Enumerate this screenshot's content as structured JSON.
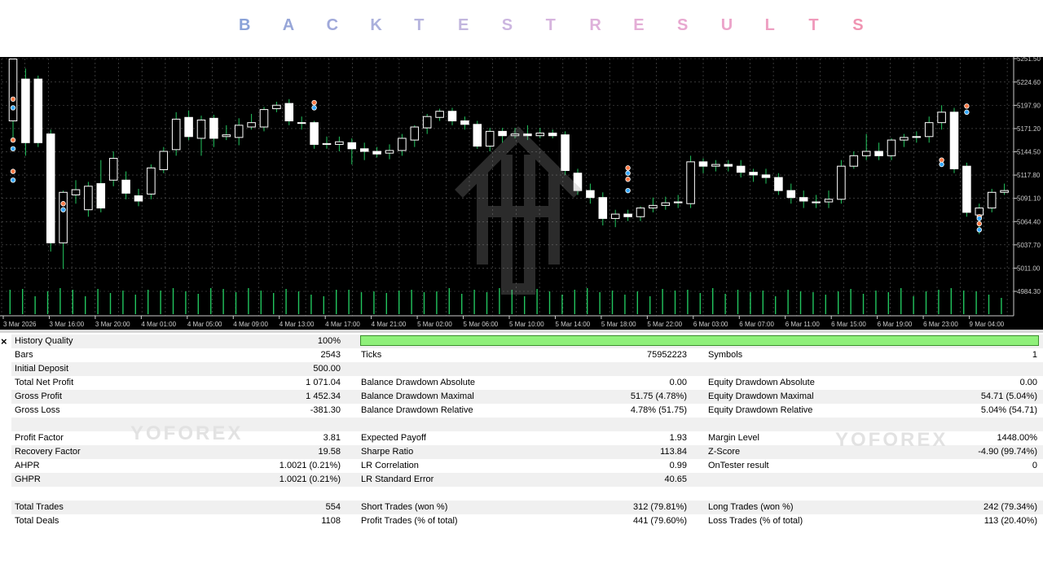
{
  "title_letters": [
    "B",
    "A",
    "C",
    "K",
    "T",
    "E",
    "S",
    "T",
    "R",
    "E",
    "S",
    "U",
    "L",
    "T",
    "S"
  ],
  "title_colors": [
    "#8aa2d8",
    "#97a6d8",
    "#a0a9da",
    "#aab0dc",
    "#b6b4de",
    "#c2b6de",
    "#ccb6e0",
    "#d6b4de",
    "#deb0da",
    "#e4aed6",
    "#e8a8d0",
    "#eca4ca",
    "#ee9fc2",
    "#f09abb",
    "#f094b2"
  ],
  "chart": {
    "price_ticks": [
      "5251.50",
      "5224.60",
      "5197.90",
      "5171.20",
      "5144.50",
      "5117.80",
      "5091.10",
      "5064.40",
      "5037.70",
      "5011.00",
      "4984.30"
    ],
    "time_ticks": [
      "3 Mar 2026",
      "3 Mar 16:00",
      "3 Mar 20:00",
      "4 Mar 01:00",
      "4 Mar 05:00",
      "4 Mar 09:00",
      "4 Mar 13:00",
      "4 Mar 17:00",
      "4 Mar 21:00",
      "5 Mar 02:00",
      "5 Mar 06:00",
      "5 Mar 10:00",
      "5 Mar 14:00",
      "5 Mar 18:00",
      "5 Mar 22:00",
      "6 Mar 03:00",
      "6 Mar 07:00",
      "6 Mar 11:00",
      "6 Mar 15:00",
      "6 Mar 19:00",
      "6 Mar 23:00",
      "9 Mar 04:00"
    ],
    "y_min": 4984.3,
    "y_max": 5251.5,
    "candles": [
      [
        5180,
        5251,
        5251,
        5160
      ],
      [
        5228,
        5155,
        5240,
        5140
      ],
      [
        5228,
        5155,
        5232,
        5150
      ],
      [
        5165,
        5040,
        5170,
        5030
      ],
      [
        5040,
        5098,
        5100,
        5010
      ],
      [
        5095,
        5101,
        5112,
        5085
      ],
      [
        5078,
        5105,
        5110,
        5070
      ],
      [
        5108,
        5080,
        5135,
        5075
      ],
      [
        5112,
        5137,
        5145,
        5105
      ],
      [
        5112,
        5097,
        5122,
        5090
      ],
      [
        5094,
        5088,
        5102,
        5082
      ],
      [
        5096,
        5126,
        5130,
        5090
      ],
      [
        5124,
        5145,
        5150,
        5120
      ],
      [
        5147,
        5182,
        5190,
        5140
      ],
      [
        5184,
        5162,
        5192,
        5158
      ],
      [
        5160,
        5181,
        5186,
        5140
      ],
      [
        5183,
        5160,
        5187,
        5150
      ],
      [
        5162,
        5164,
        5175,
        5158
      ],
      [
        5161,
        5175,
        5183,
        5152
      ],
      [
        5173,
        5178,
        5188,
        5170
      ],
      [
        5173,
        5193,
        5196,
        5168
      ],
      [
        5194,
        5198,
        5202,
        5190
      ],
      [
        5200,
        5180,
        5205,
        5175
      ],
      [
        5178,
        5178,
        5185,
        5170
      ],
      [
        5178,
        5153,
        5180,
        5148
      ],
      [
        5153,
        5154,
        5162,
        5148
      ],
      [
        5153,
        5156,
        5162,
        5145
      ],
      [
        5155,
        5148,
        5160,
        5130
      ],
      [
        5148,
        5145,
        5155,
        5135
      ],
      [
        5145,
        5142,
        5150,
        5138
      ],
      [
        5143,
        5146,
        5153,
        5136
      ],
      [
        5146,
        5160,
        5165,
        5140
      ],
      [
        5158,
        5173,
        5175,
        5150
      ],
      [
        5172,
        5185,
        5188,
        5165
      ],
      [
        5184,
        5191,
        5194,
        5180
      ],
      [
        5191,
        5180,
        5195,
        5175
      ],
      [
        5180,
        5176,
        5185,
        5170
      ],
      [
        5176,
        5151,
        5180,
        5148
      ],
      [
        5151,
        5168,
        5172,
        5145
      ],
      [
        5168,
        5163,
        5172,
        5155
      ],
      [
        5163,
        5165,
        5172,
        5160
      ],
      [
        5165,
        5163,
        5175,
        5158
      ],
      [
        5163,
        5166,
        5172,
        5160
      ],
      [
        5166,
        5163,
        5170,
        5160
      ],
      [
        5164,
        5123,
        5168,
        5118
      ],
      [
        5120,
        5100,
        5125,
        5095
      ],
      [
        5100,
        5092,
        5108,
        5085
      ],
      [
        5092,
        5068,
        5098,
        5060
      ],
      [
        5068,
        5073,
        5078,
        5058
      ],
      [
        5073,
        5070,
        5078,
        5065
      ],
      [
        5070,
        5080,
        5082,
        5065
      ],
      [
        5080,
        5083,
        5092,
        5075
      ],
      [
        5083,
        5086,
        5093,
        5078
      ],
      [
        5086,
        5087,
        5095,
        5080
      ],
      [
        5085,
        5133,
        5140,
        5080
      ],
      [
        5133,
        5128,
        5137,
        5120
      ],
      [
        5128,
        5130,
        5135,
        5122
      ],
      [
        5130,
        5128,
        5135,
        5122
      ],
      [
        5128,
        5121,
        5135,
        5115
      ],
      [
        5121,
        5118,
        5125,
        5110
      ],
      [
        5118,
        5115,
        5125,
        5108
      ],
      [
        5115,
        5100,
        5120,
        5095
      ],
      [
        5100,
        5092,
        5108,
        5085
      ],
      [
        5092,
        5088,
        5100,
        5080
      ],
      [
        5086,
        5087,
        5095,
        5080
      ],
      [
        5087,
        5090,
        5100,
        5080
      ],
      [
        5090,
        5128,
        5135,
        5085
      ],
      [
        5128,
        5140,
        5145,
        5125
      ],
      [
        5140,
        5145,
        5165,
        5135
      ],
      [
        5145,
        5140,
        5155,
        5135
      ],
      [
        5140,
        5158,
        5160,
        5135
      ],
      [
        5158,
        5161,
        5165,
        5150
      ],
      [
        5161,
        5162,
        5168,
        5155
      ],
      [
        5162,
        5178,
        5185,
        5155
      ],
      [
        5178,
        5190,
        5198,
        5170
      ],
      [
        5190,
        5125,
        5195,
        5120
      ],
      [
        5128,
        5075,
        5132,
        5070
      ],
      [
        5072,
        5080,
        5085,
        5050
      ],
      [
        5080,
        5098,
        5102,
        5075
      ],
      [
        5098,
        5100,
        5108,
        5095
      ]
    ],
    "volumes": [
      30,
      31,
      22,
      28,
      32,
      30,
      22,
      31,
      26,
      29,
      24,
      30,
      29,
      32,
      28,
      25,
      32,
      31,
      27,
      32,
      29,
      26,
      31,
      28,
      24,
      22,
      30,
      30,
      27,
      28,
      26,
      29,
      30,
      27,
      28,
      32,
      25,
      30,
      27,
      32,
      30,
      22,
      31,
      28,
      24,
      30,
      32,
      27,
      29,
      24,
      28,
      22,
      31,
      29,
      30,
      26,
      32,
      25,
      30,
      27,
      29,
      22,
      30,
      28,
      27,
      24,
      28,
      31,
      25,
      29,
      27,
      32,
      22,
      28,
      30,
      32,
      29,
      28,
      24,
      20
    ],
    "trade_markers": [
      [
        0,
        5205
      ],
      [
        0,
        5195
      ],
      [
        0,
        5158
      ],
      [
        0,
        5148
      ],
      [
        0,
        5122
      ],
      [
        0,
        5112
      ],
      [
        4,
        5085
      ],
      [
        4,
        5078
      ],
      [
        24,
        5201
      ],
      [
        24,
        5195
      ],
      [
        49,
        5126
      ],
      [
        49,
        5120
      ],
      [
        49,
        5113
      ],
      [
        49,
        5100
      ],
      [
        74,
        5135
      ],
      [
        74,
        5130
      ],
      [
        76,
        5197
      ],
      [
        76,
        5190
      ],
      [
        77,
        5070
      ],
      [
        77,
        5068
      ],
      [
        77,
        5062
      ],
      [
        77,
        5055
      ]
    ]
  },
  "report": {
    "quality": {
      "label": "History Quality",
      "value": "100%"
    },
    "rows": [
      {
        "c1": [
          "Bars",
          "2543"
        ],
        "c2": [
          "Ticks",
          "75952223"
        ],
        "c3": [
          "Symbols",
          "1"
        ]
      },
      {
        "c1": [
          "Initial Deposit",
          "500.00"
        ],
        "c2": [
          "",
          ""
        ],
        "c3": [
          "",
          ""
        ]
      },
      {
        "c1": [
          "Total Net Profit",
          "1 071.04"
        ],
        "c2": [
          "Balance Drawdown Absolute",
          "0.00"
        ],
        "c3": [
          "Equity Drawdown Absolute",
          "0.00"
        ]
      },
      {
        "c1": [
          "Gross Profit",
          "1 452.34"
        ],
        "c2": [
          "Balance Drawdown Maximal",
          "51.75 (4.78%)"
        ],
        "c3": [
          "Equity Drawdown Maximal",
          "54.71 (5.04%)"
        ]
      },
      {
        "c1": [
          "Gross Loss",
          "-381.30"
        ],
        "c2": [
          "Balance Drawdown Relative",
          "4.78% (51.75)"
        ],
        "c3": [
          "Equity Drawdown Relative",
          "5.04% (54.71)"
        ]
      },
      {
        "c1": [
          "",
          ""
        ],
        "c2": [
          "",
          ""
        ],
        "c3": [
          "",
          ""
        ]
      },
      {
        "c1": [
          "Profit Factor",
          "3.81"
        ],
        "c2": [
          "Expected Payoff",
          "1.93"
        ],
        "c3": [
          "Margin Level",
          "1448.00%"
        ]
      },
      {
        "c1": [
          "Recovery Factor",
          "19.58"
        ],
        "c2": [
          "Sharpe Ratio",
          "113.84"
        ],
        "c3": [
          "Z-Score",
          "-4.90 (99.74%)"
        ]
      },
      {
        "c1": [
          "AHPR",
          "1.0021 (0.21%)"
        ],
        "c2": [
          "LR Correlation",
          "0.99"
        ],
        "c3": [
          "OnTester result",
          "0"
        ]
      },
      {
        "c1": [
          "GHPR",
          "1.0021 (0.21%)"
        ],
        "c2": [
          "LR Standard Error",
          "40.65"
        ],
        "c3": [
          "",
          ""
        ]
      },
      {
        "c1": [
          "",
          ""
        ],
        "c2": [
          "",
          ""
        ],
        "c3": [
          "",
          ""
        ]
      },
      {
        "c1": [
          "Total Trades",
          "554"
        ],
        "c2": [
          "Short Trades (won %)",
          "312 (79.81%)"
        ],
        "c3": [
          "Long Trades (won %)",
          "242 (79.34%)"
        ]
      },
      {
        "c1": [
          "Total Deals",
          "1108"
        ],
        "c2": [
          "Profit Trades (% of total)",
          "441 (79.60%)"
        ],
        "c3": [
          "Loss Trades (% of total)",
          "113 (20.40%)"
        ]
      }
    ]
  },
  "watermark": {
    "text": "YOFOREX"
  },
  "colors": {
    "bull": "#ffffff",
    "bear": "#ffffff",
    "wick": "#22c55e",
    "volume": "#22c55e",
    "grid": "#5a5a5a",
    "quality_bar": "#8ff07a",
    "row_stripe": "#f0f0f0"
  }
}
